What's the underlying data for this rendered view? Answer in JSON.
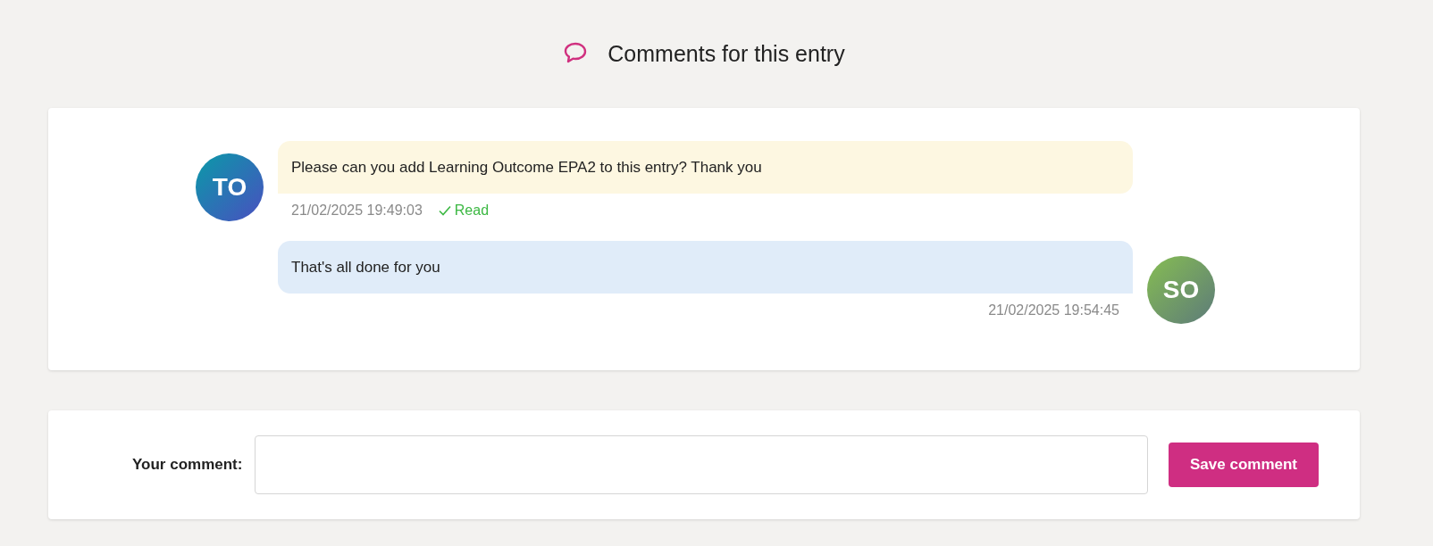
{
  "header": {
    "title": "Comments for this entry"
  },
  "messages": [
    {
      "kind": "incoming",
      "initials": "TO",
      "text": "Please can you add Learning Outcome EPA2 to this entry? Thank you",
      "time": "21/02/2025 19:49:03",
      "status": "Read"
    },
    {
      "kind": "outgoing",
      "initials": "SO",
      "text": "That's all done for you",
      "time": "21/02/2025 19:54:45"
    }
  ],
  "form": {
    "label": "Your comment:",
    "button": "Save comment"
  }
}
